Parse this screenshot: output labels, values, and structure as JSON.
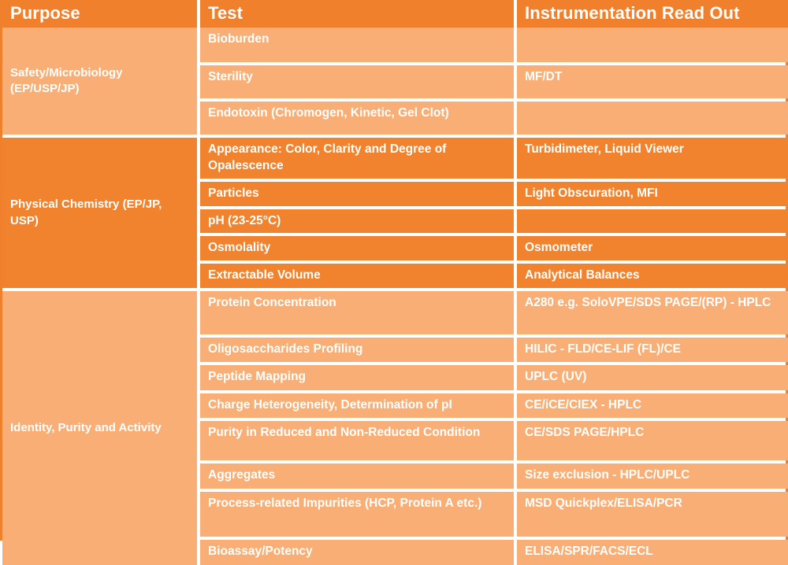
{
  "table": {
    "headers": {
      "purpose": "Purpose",
      "test": "Test",
      "readout": "Instrumentation Read Out"
    },
    "colors": {
      "header_bg": "#F1802D",
      "light_bg": "#F8AE74",
      "dark_bg": "#F2832E",
      "text": "#FFFFFF",
      "border": "#FFFFFF"
    },
    "sections": [
      {
        "purpose": "Safety/Microbiology (EP/USP/JP)",
        "tint": "light",
        "rows": [
          {
            "test": "Bioburden",
            "readout": ""
          },
          {
            "test": "Sterility",
            "readout": "MF/DT"
          },
          {
            "test": "Endotoxin (Chromogen, Kinetic, Gel Clot)",
            "readout": ""
          }
        ]
      },
      {
        "purpose": "Physical Chemistry (EP/JP, USP)",
        "tint": "dark",
        "rows": [
          {
            "test": "Appearance: Color, Clarity and Degree of Opalescence",
            "readout": "Turbidimeter, Liquid Viewer"
          },
          {
            "test": "Particles",
            "readout": "Light Obscuration, MFI"
          },
          {
            "test": "pH (23-25°C)",
            "readout": ""
          },
          {
            "test": "Osmolality",
            "readout": "Osmometer"
          },
          {
            "test": "Extractable Volume",
            "readout": "Analytical Balances"
          }
        ]
      },
      {
        "purpose": "Identity, Purity and Activity",
        "tint": "light",
        "rows": [
          {
            "test": "Protein Concentration",
            "readout": "A280 e.g. SoloVPE/SDS PAGE/(RP) - HPLC"
          },
          {
            "test": "Oligosaccharides Profiling",
            "readout": "HILIC - FLD/CE-LIF (FL)/CE"
          },
          {
            "test": "Peptide Mapping",
            "readout": "UPLC (UV)"
          },
          {
            "test": "Charge Heterogeneity, Determination of pI",
            "readout": "CE/iCE/CIEX - HPLC"
          },
          {
            "test": "Purity in Reduced and Non-Reduced Condition",
            "readout": "CE/SDS PAGE/HPLC"
          },
          {
            "test": "Aggregates",
            "readout": "Size exclusion - HPLC/UPLC"
          },
          {
            "test": "Process-related Impurities (HCP, Protein A etc.)",
            "readout": "MSD Quickplex/ELISA/PCR"
          },
          {
            "test": "Bioassay/Potency",
            "readout": "ELISA/SPR/FACS/ECL"
          }
        ]
      }
    ]
  }
}
